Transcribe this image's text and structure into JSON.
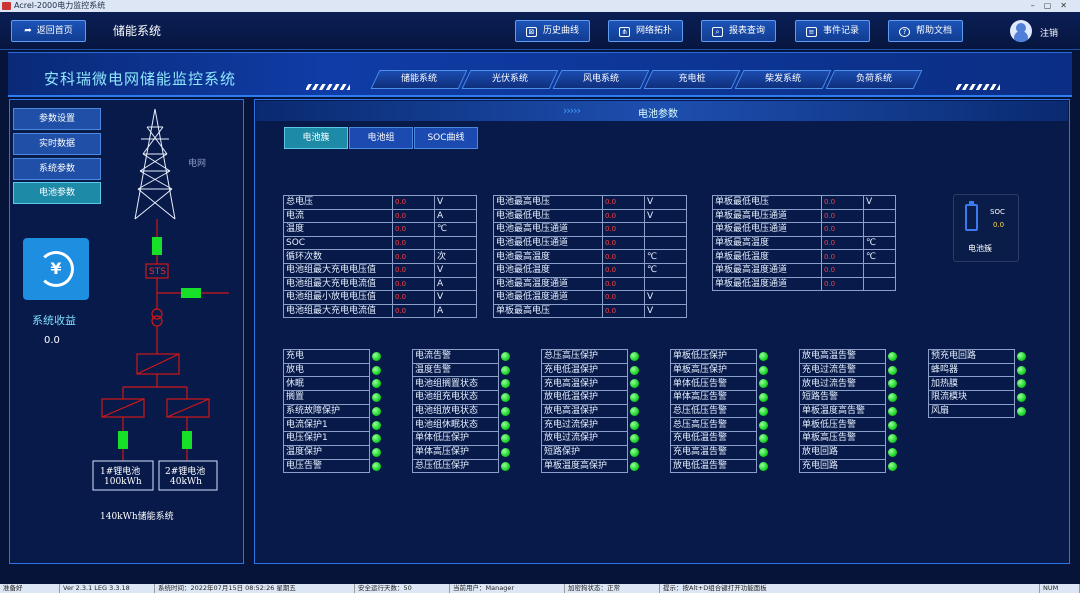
{
  "window": {
    "title": "Acrel-2000电力监控系统"
  },
  "topbar": {
    "back_label": "返回首页",
    "system_name": "储能系统",
    "buttons": [
      "历史曲线",
      "网络拓扑",
      "报表查询",
      "事件记录",
      "帮助文档"
    ],
    "logout": "注销"
  },
  "banner": {
    "title": "安科瑞微电网储能监控系统",
    "tabs": [
      "储能系统",
      "光伏系统",
      "风电系统",
      "充电桩",
      "柴发系统",
      "负荷系统"
    ]
  },
  "left": {
    "menu": [
      "参数设置",
      "实时数据",
      "系统参数",
      "电池参数"
    ],
    "active_menu": 3,
    "grid_label": "电网",
    "sts_label": "STS",
    "battery1": {
      "name": "1#锂电池",
      "capacity": "100kWh"
    },
    "battery2": {
      "name": "2#锂电池",
      "capacity": "40kWh"
    },
    "system_label": "140kWh储能系统",
    "income_label": "系统收益",
    "income_value": "0.0"
  },
  "main": {
    "header": "电池参数",
    "subtabs": [
      "电池簇",
      "电池组",
      "SOC曲线"
    ],
    "active_subtab": 0,
    "table1": [
      {
        "name": "总电压",
        "value": "0.0",
        "unit": "V"
      },
      {
        "name": "电流",
        "value": "0.0",
        "unit": "A"
      },
      {
        "name": "温度",
        "value": "0.0",
        "unit": "℃"
      },
      {
        "name": "SOC",
        "value": "0.0",
        "unit": ""
      },
      {
        "name": "循环次数",
        "value": "0.0",
        "unit": "次"
      },
      {
        "name": "电池组最大充电电压值",
        "value": "0.0",
        "unit": "V"
      },
      {
        "name": "电池组最大充电电流值",
        "value": "0.0",
        "unit": "A"
      },
      {
        "name": "电池组最小放电电压值",
        "value": "0.0",
        "unit": "V"
      },
      {
        "name": "电池组最大充电电流值",
        "value": "0.0",
        "unit": "A"
      }
    ],
    "table2": [
      {
        "name": "电池最高电压",
        "value": "0.0",
        "unit": "V"
      },
      {
        "name": "电池最低电压",
        "value": "0.0",
        "unit": "V"
      },
      {
        "name": "电池最高电压通道",
        "value": "0.0",
        "unit": ""
      },
      {
        "name": "电池最低电压通道",
        "value": "0.0",
        "unit": ""
      },
      {
        "name": "电池最高温度",
        "value": "0.0",
        "unit": "℃"
      },
      {
        "name": "电池最低温度",
        "value": "0.0",
        "unit": "℃"
      },
      {
        "name": "电池最高温度通道",
        "value": "0.0",
        "unit": ""
      },
      {
        "name": "电池最低温度通道",
        "value": "0.0",
        "unit": "V"
      },
      {
        "name": "单板最高电压",
        "value": "0.0",
        "unit": "V"
      }
    ],
    "table3": [
      {
        "name": "单板最低电压",
        "value": "0.0",
        "unit": "V"
      },
      {
        "name": "单板最高电压通道",
        "value": "0.0",
        "unit": ""
      },
      {
        "name": "单板最低电压通道",
        "value": "0.0",
        "unit": ""
      },
      {
        "name": "单板最高温度",
        "value": "0.0",
        "unit": "℃"
      },
      {
        "name": "单板最低温度",
        "value": "0.0",
        "unit": "℃"
      },
      {
        "name": "单板最高温度通道",
        "value": "0.0",
        "unit": ""
      },
      {
        "name": "单板最低温度通道",
        "value": "0.0",
        "unit": ""
      }
    ],
    "soc_card": {
      "label": "SOC",
      "value": "0.0",
      "name": "电池簇"
    },
    "status_cols": [
      [
        "充电",
        "放电",
        "休眠",
        "搁置",
        "系统故障保护",
        "电流保护1",
        "电压保护1",
        "温度保护",
        "电压告警"
      ],
      [
        "电流告警",
        "温度告警",
        "电池组搁置状态",
        "电池组充电状态",
        "电池组放电状态",
        "电池组休眠状态",
        "单体低压保护",
        "单体高压保护",
        "总压低压保护"
      ],
      [
        "总压高压保护",
        "充电低温保护",
        "充电高温保护",
        "放电低温保护",
        "放电高温保护",
        "充电过流保护",
        "放电过流保护",
        "短路保护",
        "单板温度高保护"
      ],
      [
        "单板低压保护",
        "单板高压保护",
        "单体低压告警",
        "单体高压告警",
        "总压低压告警",
        "总压高压告警",
        "充电低温告警",
        "充电高温告警",
        "放电低温告警"
      ],
      [
        "放电高温告警",
        "充电过流告警",
        "放电过流告警",
        "短路告警",
        "单板温度高告警",
        "单板低压告警",
        "单板高压告警",
        "放电回路",
        "充电回路"
      ],
      [
        "预充电回路",
        "蜂鸣器",
        "加热膜",
        "限流模块",
        "风扇"
      ]
    ],
    "status_color": "#1bd62a"
  },
  "statusbar": [
    "准备好",
    "Ver 2.3.1 LEG 3.3.18",
    "系统时间：2022年07月15日  08:52:26  星期五",
    "安全运行天数：50",
    "当前用户：Manager",
    "加密狗状态：正常",
    "提示：按Alt+D组合键打开功能面板",
    "NUM"
  ]
}
